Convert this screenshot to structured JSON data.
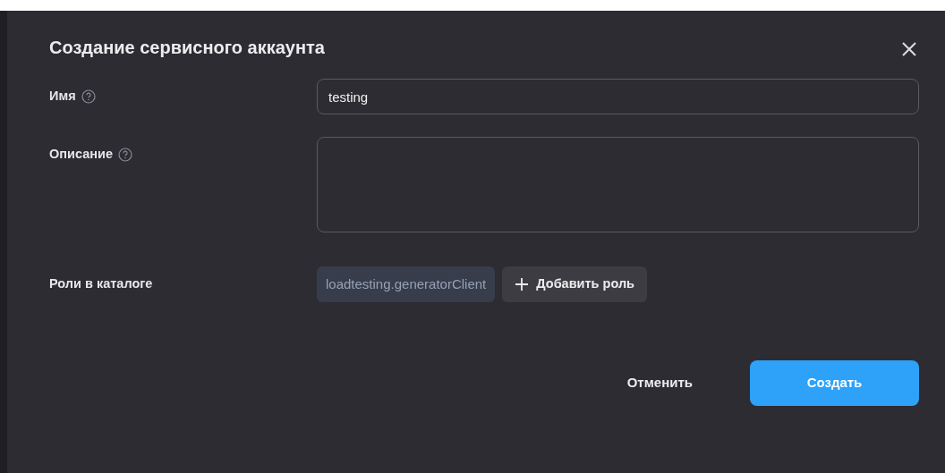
{
  "dialog": {
    "title": "Создание сервисного аккаунта"
  },
  "fields": [
    {
      "kind": "input",
      "label": "Имя",
      "value": "testing"
    },
    {
      "kind": "textarea",
      "label": "Описание"
    }
  ],
  "roles": {
    "label": "Роли в каталоге",
    "items": [
      "loadtesting.generatorClient"
    ],
    "add_button": "Добавить роль"
  },
  "buttons": {
    "cancel": "Отменить",
    "submit": "Создать"
  }
}
